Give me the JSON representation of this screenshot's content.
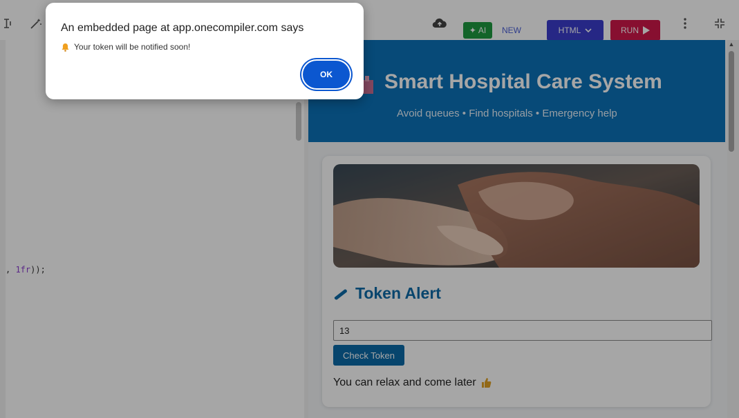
{
  "toolbar": {
    "ai_label": "AI",
    "new_label": "NEW",
    "language_label": "HTML",
    "run_label": "RUN",
    "icons": [
      "insert-icon",
      "magic-wand-icon",
      "cloud-upload-icon",
      "sparkle-icon",
      "chevron-down-icon",
      "play-icon",
      "more-vertical-icon",
      "collapse-icon"
    ]
  },
  "editor": {
    "code_prefix": ", ",
    "code_number": "1fr",
    "code_suffix": "));"
  },
  "preview": {
    "header_title": "Smart Hospital Care System",
    "header_subtitle": "Avoid queues • Find hospitals • Emergency help",
    "card_title": "Token Alert",
    "token_value": "13",
    "check_button": "Check Token",
    "result_text": "You can relax and come later"
  },
  "dialog": {
    "title": "An embedded page at app.onecompiler.com says",
    "message": "Your token will be notified soon!",
    "ok_label": "OK"
  },
  "colors": {
    "header_blue": "#0b72b8",
    "ai_green": "#1e9a3f",
    "html_button": "#3b3ccd",
    "run_button": "#d0174a",
    "dialog_ok": "#0b57d0"
  }
}
